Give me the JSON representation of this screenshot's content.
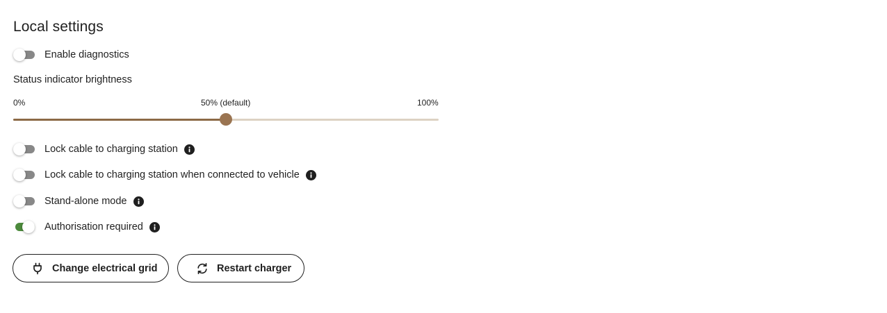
{
  "title": "Local settings",
  "toggles": [
    {
      "label": "Enable diagnostics",
      "on": false,
      "info": false
    },
    {
      "label": "Lock cable to charging station",
      "on": false,
      "info": true
    },
    {
      "label": "Lock cable to charging station when connected to vehicle",
      "on": false,
      "info": true
    },
    {
      "label": "Stand-alone mode",
      "on": false,
      "info": true
    },
    {
      "label": "Authorisation required",
      "on": true,
      "info": true
    }
  ],
  "brightness": {
    "label": "Status indicator brightness",
    "min_label": "0%",
    "mid_label": "50% (default)",
    "max_label": "100%",
    "value_percent": 50
  },
  "buttons": {
    "change_grid": {
      "label": "Change electrical grid",
      "icon": "plug-icon"
    },
    "restart": {
      "label": "Restart charger",
      "icon": "refresh-icon"
    }
  },
  "colors": {
    "toggle_on": "#4c8a3c",
    "toggle_off": "#888888",
    "slider_fill": "#8c6a46",
    "slider_rail": "#ddd2c3",
    "slider_knob": "#9a7451"
  }
}
